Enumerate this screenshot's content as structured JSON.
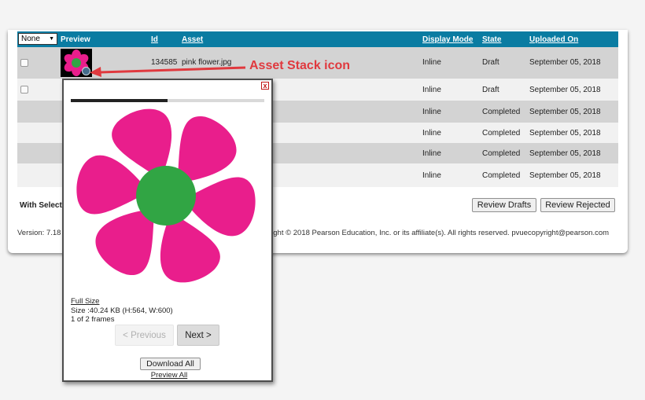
{
  "header": {
    "filter_value": "None",
    "columns": {
      "preview": "Preview",
      "id": "Id",
      "asset": "Asset",
      "display_mode": "Display Mode",
      "state": "State",
      "uploaded_on": "Uploaded On"
    }
  },
  "rows": [
    {
      "id": "134585",
      "asset": "pink flower.jpg",
      "display_mode": "Inline",
      "state": "Draft",
      "uploaded_on": "September 05, 2018"
    },
    {
      "id": "",
      "asset": "",
      "display_mode": "Inline",
      "state": "Draft",
      "uploaded_on": "September 05, 2018"
    },
    {
      "id": "",
      "asset": "",
      "display_mode": "Inline",
      "state": "Completed",
      "uploaded_on": "September 05, 2018"
    },
    {
      "id": "",
      "asset": "",
      "display_mode": "Inline",
      "state": "Completed",
      "uploaded_on": "September 05, 2018"
    },
    {
      "id": "",
      "asset": "",
      "display_mode": "Inline",
      "state": "Completed",
      "uploaded_on": "September 05, 2018"
    },
    {
      "id": "",
      "asset": "",
      "display_mode": "Inline",
      "state": "Completed",
      "uploaded_on": "September 05, 2018"
    }
  ],
  "footer": {
    "with_selected": "With Select",
    "review_drafts": "Review Drafts",
    "review_rejected": "Review Rejected",
    "version": "Version: 7.18",
    "copyright": "right © 2018 Pearson Education, Inc. or its affiliate(s). All rights reserved. pvuecopyright@pearson.com"
  },
  "annotation": {
    "label": "Asset Stack icon",
    "color": "#e0393e"
  },
  "popup": {
    "close": "x",
    "progress": 0.5,
    "full_size": "Full Size",
    "size": "Size :40.24 KB (H:564, W:600)",
    "frames": "1 of 2 frames",
    "previous": "< Previous",
    "next": "Next >",
    "download_all": "Download All",
    "preview_all": "Preview All"
  },
  "colors": {
    "header_bg": "#0a7ca2",
    "row_alt": "#d3d3d3",
    "row_plain": "#f1f1f1",
    "petal": "#e91e8c",
    "flower_center": "#31a544"
  },
  "icons": {
    "stack": "asset-stack-icon",
    "close": "close-icon"
  }
}
